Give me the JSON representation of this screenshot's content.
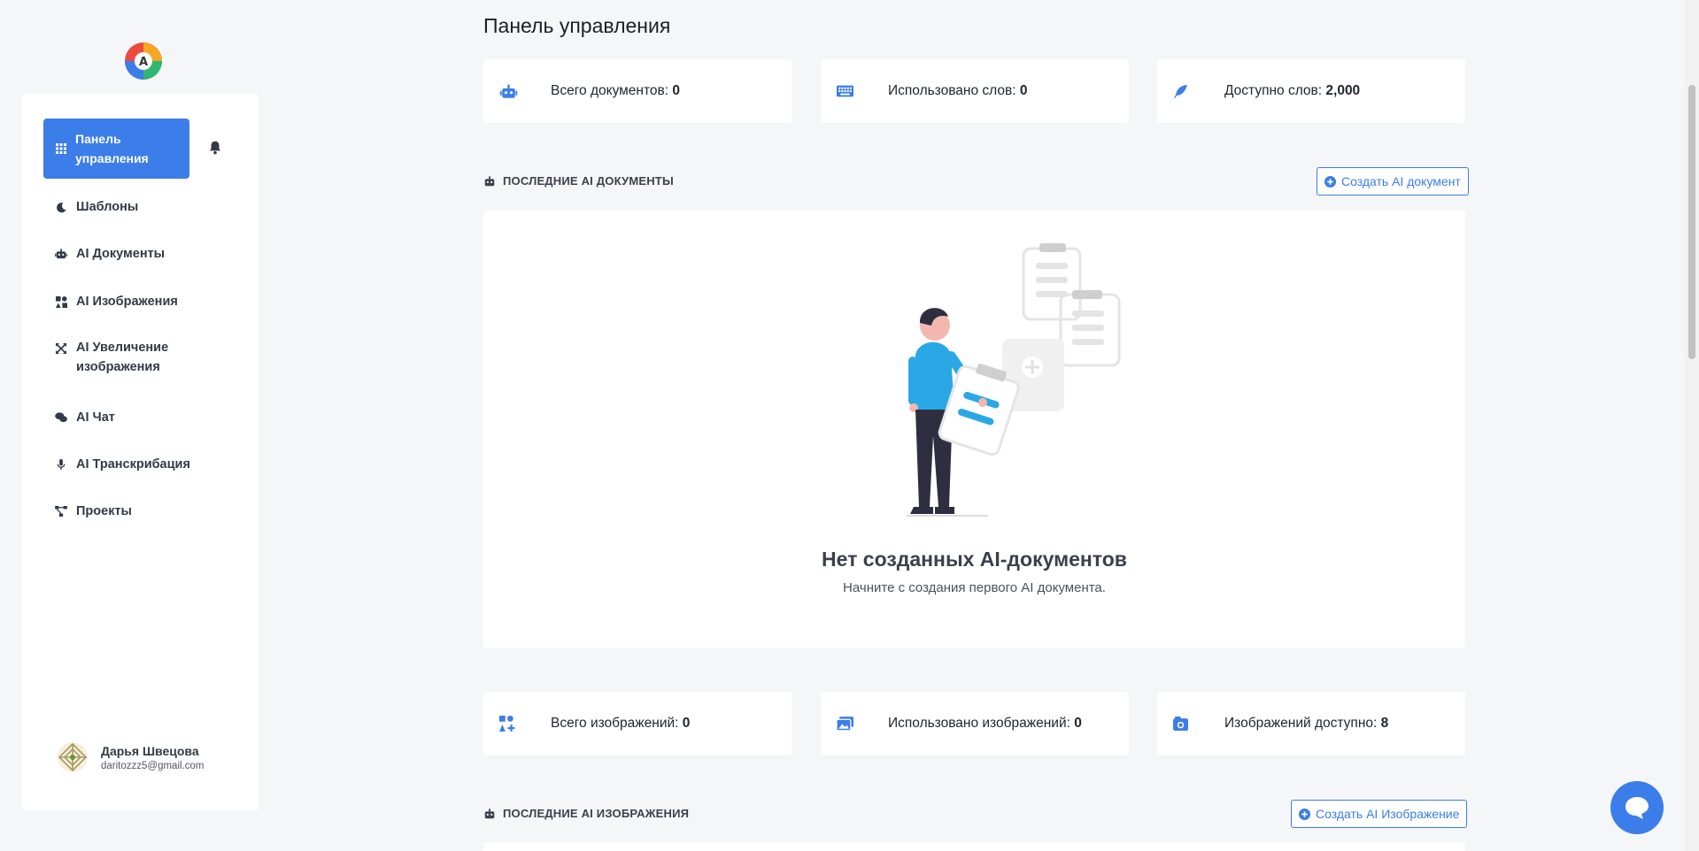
{
  "sidebar": {
    "active": {
      "label": "Панель управления",
      "icon": "grid-icon"
    },
    "items": [
      {
        "label": "Шаблоны",
        "icon": "moon-icon"
      },
      {
        "label": "AI Документы",
        "icon": "robot-icon"
      },
      {
        "label": "AI Изображения",
        "icon": "images-icon"
      },
      {
        "label": "AI Увеличение изображения",
        "icon": "expand-icon"
      },
      {
        "label": "AI Чат",
        "icon": "chat-icon"
      },
      {
        "label": "AI Транскрибация",
        "icon": "mic-icon"
      },
      {
        "label": "Проекты",
        "icon": "diagram-icon"
      }
    ],
    "user": {
      "name": "Дарья Швецова",
      "email": "daritozzz5@gmail.com"
    }
  },
  "main": {
    "title": "Панель управления",
    "doc_stats": [
      {
        "label": "Всего документов:",
        "value": "0",
        "icon": "robot-icon"
      },
      {
        "label": "Использовано слов:",
        "value": "0",
        "icon": "keyboard-icon"
      },
      {
        "label": "Доступно слов:",
        "value": "2,000",
        "icon": "feather-icon"
      }
    ],
    "recent_docs": {
      "heading": "ПОСЛЕДНИЕ AI ДОКУМЕНТЫ",
      "button": "Создать AI документ",
      "empty_title": "Нет созданных AI-документов",
      "empty_sub": "Начните с создания первого AI документа."
    },
    "image_stats": [
      {
        "label": "Всего изображений:",
        "value": "0",
        "icon": "image-plus-icon"
      },
      {
        "label": "Использовано изображений:",
        "value": "0",
        "icon": "images-icon"
      },
      {
        "label": "Изображений доступно:",
        "value": "8",
        "icon": "camera-icon"
      }
    ],
    "recent_images": {
      "heading": "ПОСЛЕДНИЕ AI ИЗОБРАЖЕНИЯ",
      "button": "Создать AI Изображение"
    }
  },
  "colors": {
    "accent": "#3b7de9",
    "background": "#f5f6f8"
  }
}
